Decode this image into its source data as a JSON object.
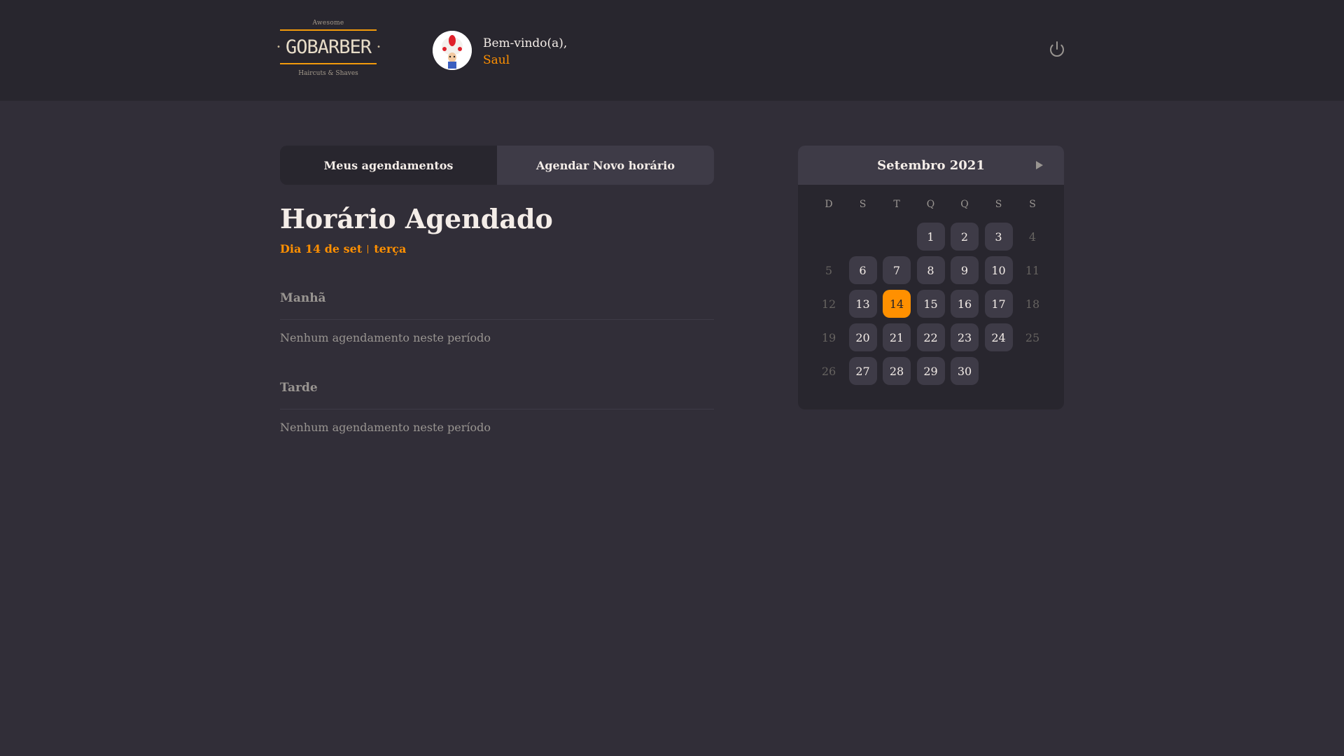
{
  "header": {
    "logo": {
      "top": "Awesome",
      "main": "GOBARBER",
      "bottom": "Haircuts & Shaves"
    },
    "greeting": "Bem-vindo(a),",
    "user_name": "Saul",
    "avatar_icon": "mushroom-avatar-icon",
    "signout_icon": "power-icon"
  },
  "tabs": {
    "my_appointments": "Meus agendamentos",
    "new_appointment": "Agendar Novo horário",
    "active": "my_appointments"
  },
  "schedule": {
    "title": "Horário Agendado",
    "day_label": "Dia 14 de set",
    "weekday_label": "terça",
    "morning": {
      "title": "Manhã",
      "empty": "Nenhum agendamento neste período"
    },
    "afternoon": {
      "title": "Tarde",
      "empty": "Nenhum agendamento neste período"
    }
  },
  "calendar": {
    "month_label": "Setembro 2021",
    "weekdays": [
      "D",
      "S",
      "T",
      "Q",
      "Q",
      "S",
      "S"
    ],
    "selected_day": "14",
    "weeks": [
      [
        "",
        "",
        "",
        "1",
        "2",
        "3",
        "4"
      ],
      [
        "5",
        "6",
        "7",
        "8",
        "9",
        "10",
        "11"
      ],
      [
        "12",
        "13",
        "14",
        "15",
        "16",
        "17",
        "18"
      ],
      [
        "19",
        "20",
        "21",
        "22",
        "23",
        "24",
        "25"
      ],
      [
        "26",
        "27",
        "28",
        "29",
        "30",
        "",
        ""
      ]
    ],
    "disabled_days": [
      "4",
      "5",
      "11",
      "12",
      "18",
      "19",
      "25",
      "26"
    ]
  },
  "colors": {
    "accent": "#ff9000",
    "background": "#312e38",
    "header": "#28262e",
    "card": "#3e3b47"
  }
}
